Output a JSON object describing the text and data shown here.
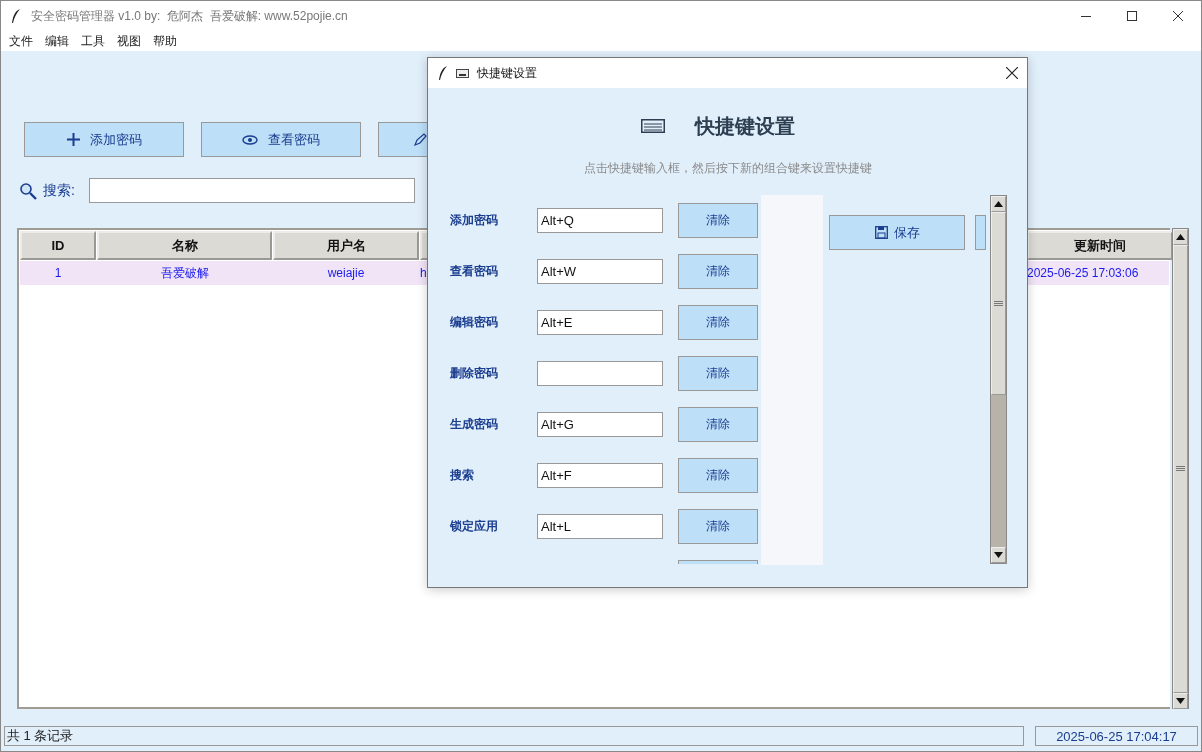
{
  "window": {
    "title": "安全密码管理器 v1.0 by:  危阿杰  吾爱破解: www.52pojie.cn"
  },
  "menu": [
    "文件",
    "编辑",
    "工具",
    "视图",
    "帮助"
  ],
  "toolbar": [
    {
      "kind": "add",
      "label": "添加密码"
    },
    {
      "kind": "view",
      "label": "查看密码"
    },
    {
      "kind": "edit"
    }
  ],
  "search": {
    "label": "搜索:"
  },
  "table": {
    "columns": [
      {
        "label": "ID"
      },
      {
        "label": "名称"
      },
      {
        "label": "用户名"
      },
      {
        "label": "更新时间"
      }
    ],
    "rows": [
      {
        "id": "1",
        "name": "吾爱破解",
        "username": "weiajie",
        "column_4": "h",
        "updated": "2025-06-25 17:03:06"
      }
    ]
  },
  "status_bar": {
    "count": "共 1 条记录",
    "time": "2025-06-25 17:04:17"
  },
  "dialog": {
    "title": "快捷键设置",
    "heading": "快捷键设置",
    "hint": "点击快捷键输入框，然后按下新的组合键来设置快捷键",
    "shortcuts": [
      {
        "label": "添加密码",
        "value": "Alt+Q",
        "clear": "清除"
      },
      {
        "label": "查看密码",
        "value": "Alt+W",
        "clear": "清除"
      },
      {
        "label": "编辑密码",
        "value": "Alt+E",
        "clear": "清除"
      },
      {
        "label": "删除密码",
        "clear": "清除"
      },
      {
        "label": "生成密码",
        "value": "Alt+G",
        "clear": "清除"
      },
      {
        "label": "搜索",
        "value": "Alt+F",
        "clear": "清除"
      },
      {
        "label": "锁定应用",
        "value": "Alt+L",
        "clear": "清除"
      }
    ],
    "save": "保存"
  }
}
